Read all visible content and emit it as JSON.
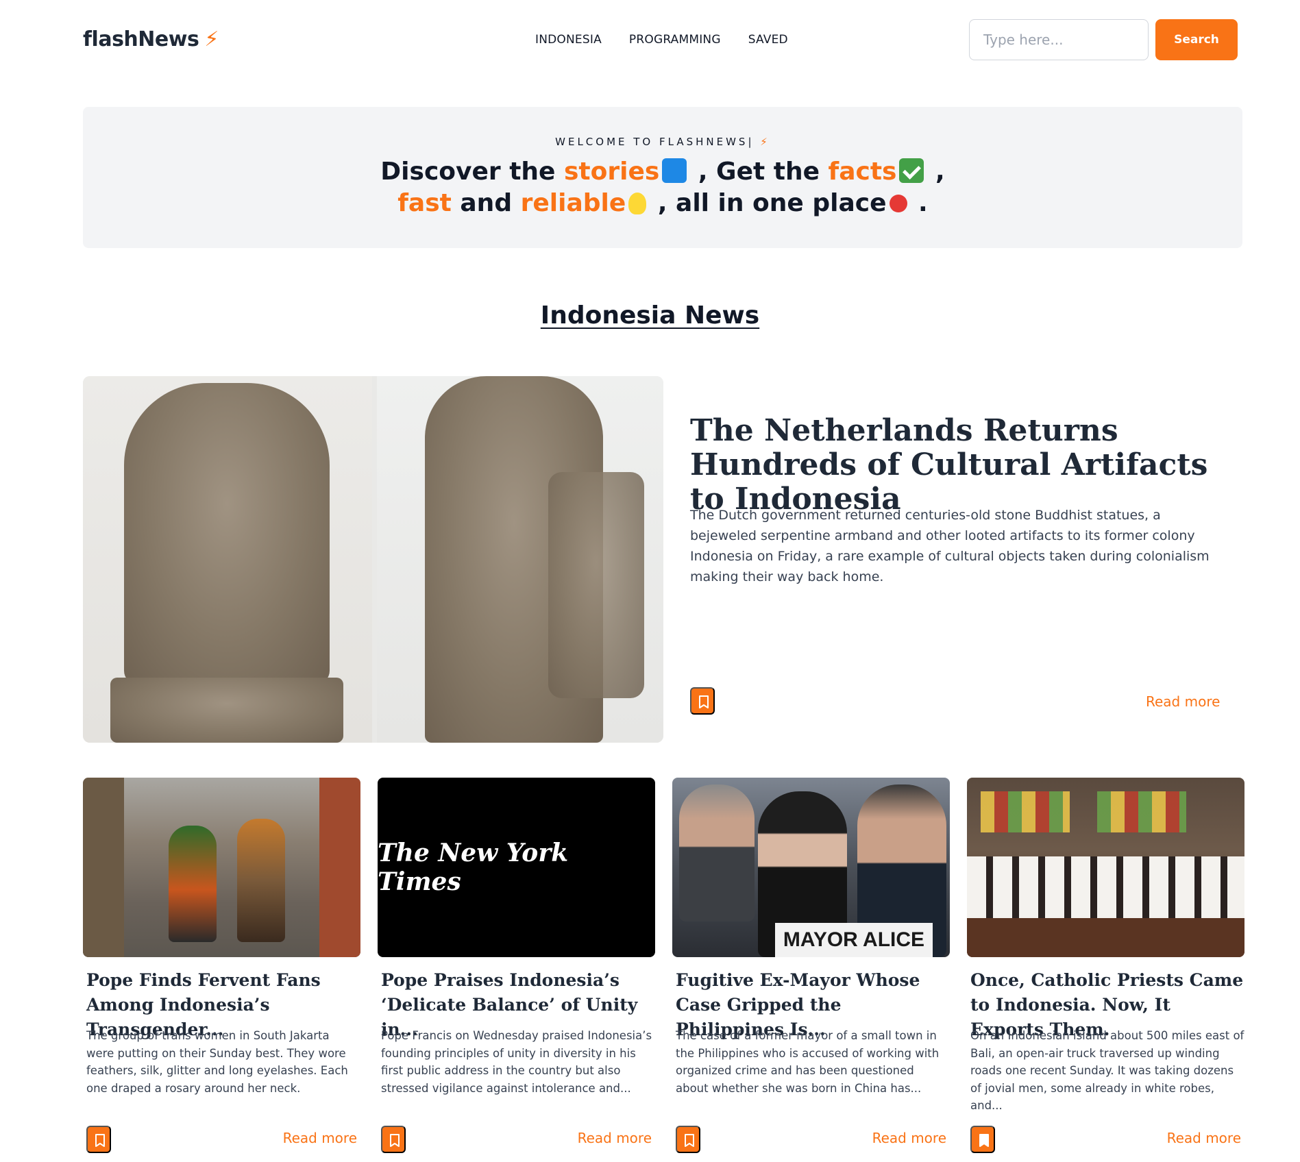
{
  "header": {
    "logo_text": "flashNews",
    "logo_icon": "⚡",
    "nav": [
      "INDONESIA",
      "PROGRAMMING",
      "SAVED"
    ],
    "search_placeholder": "Type here...",
    "search_value": "",
    "search_label": "Search"
  },
  "hero": {
    "kicker": "WELCOME TO FLASHNEWS|",
    "kicker_icon": "⚡",
    "line1": {
      "a": "Discover the ",
      "b": "stories",
      "c": " , Get the ",
      "d": "facts",
      "e": " ,"
    },
    "line2": {
      "a": "fast",
      "b": " and ",
      "c": "reliable",
      "d": " , all in one place",
      "e": " ."
    },
    "accent_color": "#f97316",
    "emojis": [
      "blue-book-icon",
      "check-mark-icon",
      "light-bulb-icon",
      "pushpin-icon"
    ]
  },
  "section": {
    "title": "Indonesia News"
  },
  "featured": {
    "title": "The Netherlands Returns Hundreds of Cultural Artifacts to Indonesia",
    "description": "The Dutch government returned centuries-old stone Buddhist statues, a bejeweled serpentine armband and other looted artifacts to its former colony Indonesia on Friday, a rare example of cultural objects taken during colonialism making their way back home.",
    "read_more": "Read more"
  },
  "cards": [
    {
      "title": "Pope Finds Fervent Fans Among Indonesia’s Transgender...",
      "description": "The group of trans women in South Jakarta were putting on their Sunday best. They wore feathers, silk, glitter and long eyelashes. Each one draped a rosary around her neck.",
      "read_more": "Read more"
    },
    {
      "title": "Pope Praises Indonesia’s ‘Delicate Balance’ of Unity in...",
      "description": "Pope Francis on Wednesday praised Indonesia’s founding principles of unity in diversity in his first public address in the country but also stressed vigilance against intolerance and...",
      "read_more": "Read more",
      "image_text": "The New York Times"
    },
    {
      "title": "Fugitive Ex-Mayor Whose Case Gripped the Philippines Is...",
      "description": "The case of a former mayor of a small town in the Philippines who is accused of working with organized crime and has been questioned about whether she was born in China has...",
      "read_more": "Read more",
      "image_text": "MAYOR ALICE GUO"
    },
    {
      "title": "Once, Catholic Priests Came to Indonesia. Now, It Exports Them.",
      "description": "On an Indonesian island about 500 miles east of Bali, an open-air truck traversed up winding roads one recent Sunday. It was taking dozens of jovial men, some already in white robes, and...",
      "read_more": "Read more"
    }
  ]
}
